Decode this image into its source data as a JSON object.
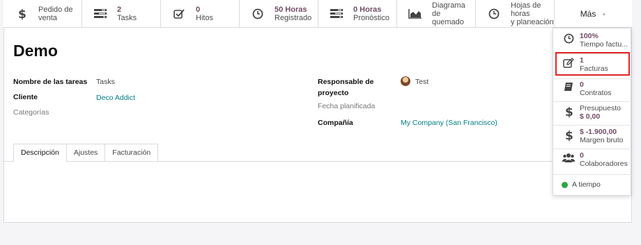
{
  "stat_buttons": [
    {
      "name": "sale-order",
      "line1": "Pedido de",
      "line2": "venta",
      "icon": "dollar-icon",
      "line1_is_value": false
    },
    {
      "name": "tasks",
      "line1": "2",
      "line2": "Tasks",
      "icon": "tasks-icon",
      "line1_is_value": true
    },
    {
      "name": "milestones",
      "line1": "0",
      "line2": "Hitos",
      "icon": "check-square-icon",
      "line1_is_value": true
    },
    {
      "name": "hours-recorded",
      "line1": "50 Horas",
      "line2": "Registrado",
      "icon": "clock-icon",
      "line1_is_value": true
    },
    {
      "name": "hours-forecast",
      "line1": "0 Horas",
      "line2": "Pronóstico",
      "icon": "tasks-icon",
      "line1_is_value": true
    },
    {
      "name": "burndown",
      "line1": "Diagrama de",
      "line2": "quemado",
      "icon": "area-chart-icon",
      "line1_is_value": false
    },
    {
      "name": "timesheets",
      "line1": "Hojas de horas",
      "line2": "y planeación",
      "icon": "clock-icon",
      "line1_is_value": false
    }
  ],
  "more_button": {
    "label": "Más"
  },
  "project": {
    "title": "Demo"
  },
  "fields": {
    "task_name_label": "Nombre de las tareas",
    "task_name_value": "Tasks",
    "customer_label": "Cliente",
    "customer_value": "Deco Addict",
    "tags_label": "Categorías",
    "manager_label_1": "Responsable de",
    "manager_label_2": "proyecto",
    "manager_value": "Test",
    "planned_date_label": "Fecha planificada",
    "company_label": "Compañía",
    "company_value": "My Company (San Francisco)"
  },
  "tabs": [
    "Descripción",
    "Ajustes",
    "Facturación"
  ],
  "dropdown": {
    "items": [
      {
        "value": "100%",
        "label": "Tiempo factu...",
        "icon": "clock-icon"
      },
      {
        "value": "1",
        "label": "Facturas",
        "icon": "edit-icon"
      },
      {
        "value": "0",
        "label": "Contratos",
        "icon": "book-icon"
      },
      {
        "value": "Presupuesto",
        "label": "$ 0,00",
        "icon": "dollar-icon"
      },
      {
        "value": "$ -1.900,00",
        "label": "Margen bruto",
        "icon": "dollar-icon"
      },
      {
        "value": "0",
        "label": "Colaboradores",
        "icon": "users-icon"
      }
    ],
    "status": "A tiempo"
  },
  "colors": {
    "accent": "#714b67",
    "link": "#017e84",
    "highlight": "#e02424",
    "status_green": "#28a745"
  }
}
